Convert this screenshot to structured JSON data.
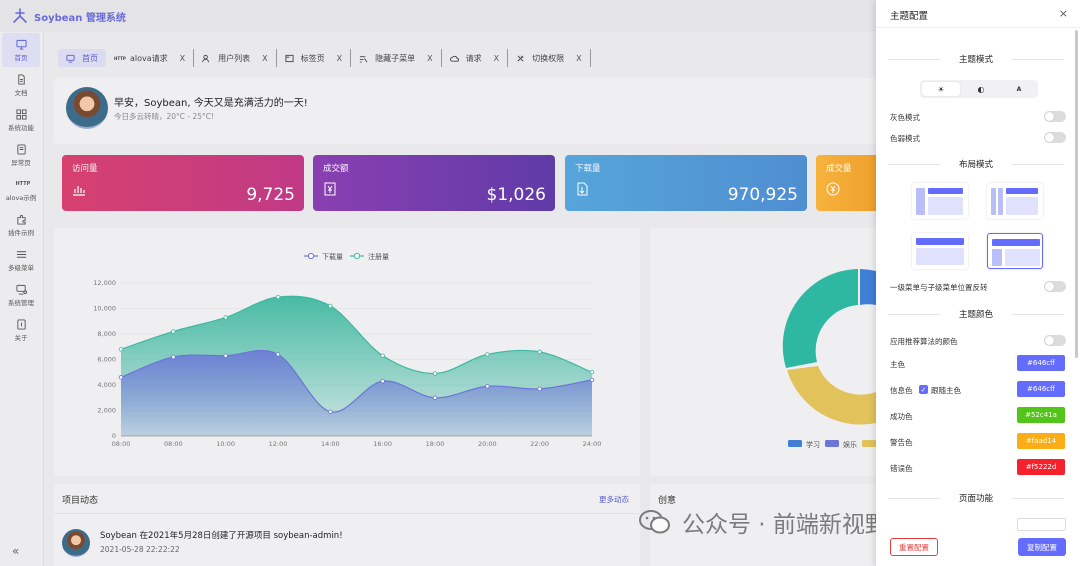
{
  "app": {
    "title": "Soybean 管理系统"
  },
  "sidebar": {
    "items": [
      {
        "label": "首页",
        "icon": "monitor-icon",
        "active": true
      },
      {
        "label": "文档",
        "icon": "document-icon"
      },
      {
        "label": "系统功能",
        "icon": "grid-icon"
      },
      {
        "label": "异常页",
        "icon": "exception-icon"
      },
      {
        "label": "alova示例",
        "icon": "http-icon"
      },
      {
        "label": "插件示例",
        "icon": "plugin-icon"
      },
      {
        "label": "多级菜单",
        "icon": "menu-icon"
      },
      {
        "label": "系统管理",
        "icon": "settings-monitor-icon"
      },
      {
        "label": "关于",
        "icon": "about-icon"
      }
    ],
    "collapse_glyph": "«"
  },
  "tabs": [
    {
      "label": "首页",
      "icon": "home-icon",
      "active": true
    },
    {
      "label": "alova请求",
      "icon": "http-icon",
      "close": "X"
    },
    {
      "label": "用户列表",
      "icon": "users-icon",
      "close": "X"
    },
    {
      "label": "标签页",
      "icon": "tab-icon",
      "close": "X"
    },
    {
      "label": "隐藏子菜单",
      "icon": "hidden-menu-icon",
      "close": "X"
    },
    {
      "label": "请求",
      "icon": "cloud-icon",
      "close": "X"
    },
    {
      "label": "切换权限",
      "icon": "tools-icon",
      "close": "X"
    }
  ],
  "greeting": {
    "title": "早安，Soybean, 今天又是充满活力的一天!",
    "subtitle": "今日多云转晴，20°C - 25°C!"
  },
  "stats": [
    {
      "label": "访问量",
      "value": "9,725",
      "icon": "bar-chart-icon",
      "gradient": [
        "#d6416f",
        "#c13a86"
      ]
    },
    {
      "label": "成交额",
      "value": "$1,026",
      "icon": "money-icon",
      "gradient": [
        "#8a3fb0",
        "#5f3ba8"
      ]
    },
    {
      "label": "下载量",
      "value": "970,925",
      "icon": "download-file-icon",
      "gradient": [
        "#56a5da",
        "#4f8ed1"
      ]
    },
    {
      "label": "成交量",
      "value": "",
      "icon": "currency-circle-icon",
      "gradient": [
        "#f6b33b",
        "#f0a02e"
      ]
    }
  ],
  "chart_data": {
    "type": "area",
    "x": [
      "08:00",
      "08:00",
      "10:00",
      "12:00",
      "14:00",
      "16:00",
      "18:00",
      "20:00",
      "22:00",
      "24:00"
    ],
    "series": [
      {
        "name": "下载量",
        "values": [
          4600,
          6200,
          6300,
          6400,
          1900,
          4300,
          3000,
          3900,
          3700,
          4400
        ],
        "color": "#6c74d9"
      },
      {
        "name": "注册量",
        "values": [
          6800,
          8200,
          9300,
          10900,
          10200,
          6300,
          4900,
          6400,
          6600,
          5000
        ],
        "color": "#3fb8a0"
      }
    ],
    "y_ticks": [
      "12,000",
      "10,000",
      "8,000",
      "6,000",
      "4,000",
      "2,000",
      "0"
    ],
    "x_ticks": [
      "08:00",
      "08:00",
      "10:00",
      "12:00",
      "14:00",
      "16:00",
      "18:00",
      "20:00",
      "22:00",
      "24:00"
    ],
    "ylim": [
      0,
      12000
    ],
    "legend_position": "top"
  },
  "pie_legend": [
    "学习",
    "娱乐"
  ],
  "activity": {
    "title": "项目动态",
    "more": "更多动态",
    "item_text": "Soybean 在2021年5月28日创建了开源项目 soybean-admin!",
    "item_time": "2021-05-28 22:22:22"
  },
  "creativity": {
    "title": "创意"
  },
  "drawer": {
    "title": "主题配置",
    "close": "×",
    "theme_mode": {
      "heading": "主题模式",
      "options": [
        "☀",
        "◐",
        "A"
      ],
      "gray_mode": "灰色模式",
      "color_weak": "色弱模式"
    },
    "layout_mode": {
      "heading": "布局模式",
      "reverse_label": "一级菜单与子级菜单位置反转"
    },
    "theme_color": {
      "heading": "主题颜色",
      "recommend_label": "应用推荐算法的颜色",
      "rows": [
        {
          "label": "主色",
          "value": "#646cff"
        },
        {
          "label": "信息色",
          "value": "#646cff",
          "follow": "跟随主色"
        },
        {
          "label": "成功色",
          "value": "#52c41a"
        },
        {
          "label": "警告色",
          "value": "#faad14"
        },
        {
          "label": "错误色",
          "value": "#f5222d"
        }
      ]
    },
    "page_func": {
      "heading": "页面功能"
    },
    "reset_button": "重置配置",
    "copy_button": "复制配置"
  },
  "watermark": {
    "text": "公众号 · 前端新视野brizer"
  }
}
